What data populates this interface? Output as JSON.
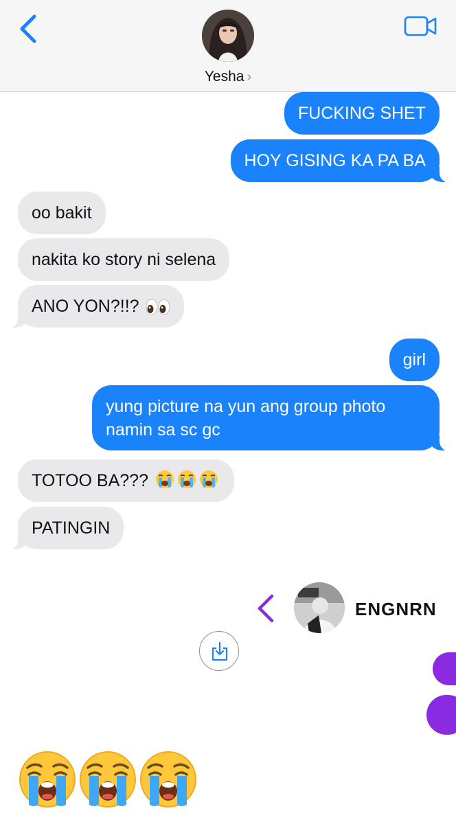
{
  "header": {
    "contact_name": "Yesha",
    "name_chevron": "›",
    "back_icon": "chevron-left-icon",
    "video_icon": "video-camera-icon",
    "accent_color": "#1a82fb"
  },
  "messages": [
    {
      "side": "sent",
      "text": "FUCKING SHET"
    },
    {
      "side": "sent",
      "text": "HOY GISING KA PA BA"
    },
    {
      "side": "received",
      "text": "oo bakit"
    },
    {
      "side": "received",
      "text": "nakita ko story ni selena"
    },
    {
      "side": "received",
      "text": "ANO YON?!!?",
      "emoji": "👀"
    },
    {
      "side": "sent",
      "text": "girl"
    },
    {
      "side": "sent",
      "text": "yung picture na yun ang group photo namin sa sc gc"
    },
    {
      "side": "received",
      "text": "TOTOO BA???",
      "emoji": "😭😭😭"
    },
    {
      "side": "received",
      "text": "PATINGIN"
    }
  ],
  "shared_screenshot": {
    "name": "ENGNRN",
    "accent_color": "#8a2be2",
    "save_icon": "download-icon"
  },
  "big_emoji_message": "😭😭😭",
  "colors": {
    "sent_bubble": "#1a82fb",
    "received_bubble": "#e9e9eb"
  }
}
